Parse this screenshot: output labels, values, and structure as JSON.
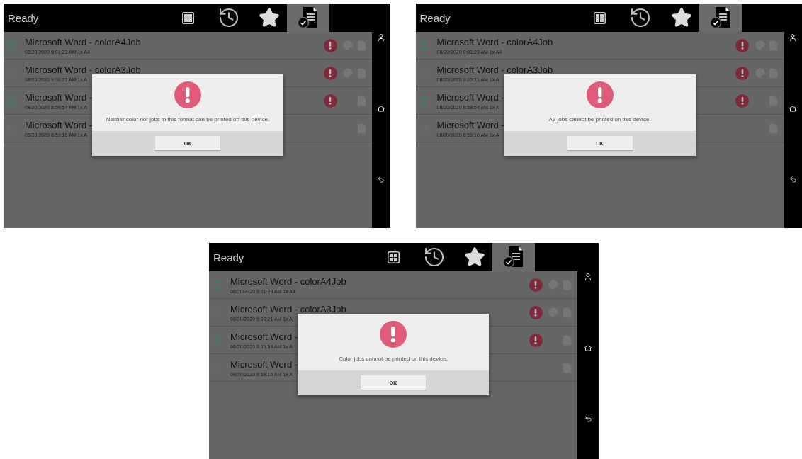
{
  "screens": [
    {
      "status": "Ready",
      "tabs": [
        {
          "kind": "grid",
          "selected": false
        },
        {
          "kind": "history",
          "selected": false
        },
        {
          "kind": "favorite",
          "selected": false
        },
        {
          "kind": "jobs",
          "selected": true
        }
      ],
      "jobs": [
        {
          "title": "Microsoft Word - colorA4Job",
          "details": "08/20/2020 9:01:23 AM 1x A4",
          "checked": false,
          "error": true,
          "color": true
        },
        {
          "title": "Microsoft Word - colorA3Job",
          "details": "08/20/2020 9:00:21 AM 1x A",
          "checked": false,
          "error": true,
          "color": true
        },
        {
          "title": "Microsoft Word -",
          "details": "08/20/2020 8:59:54 AM 1x A",
          "checked": false,
          "error": true,
          "color": false
        },
        {
          "title": "Microsoft Word -",
          "details": "08/20/2020 8:59:16 AM 1x A",
          "checked": false,
          "error": false,
          "color": false
        }
      ],
      "dialog": {
        "message": "Neither color nor jobs in this format can be printed on this device.",
        "button": "OK"
      }
    },
    {
      "status": "Ready",
      "tabs": [
        {
          "kind": "grid",
          "selected": false
        },
        {
          "kind": "history",
          "selected": false
        },
        {
          "kind": "favorite",
          "selected": false
        },
        {
          "kind": "jobs",
          "selected": true
        }
      ],
      "jobs": [
        {
          "title": "Microsoft Word - colorA4Job",
          "details": "08/20/2020 9:01:23 AM 1x A4",
          "checked": false,
          "error": true,
          "color": true
        },
        {
          "title": "Microsoft Word - colorA3Job",
          "details": "08/20/2020 9:00:21 AM 1x A",
          "checked": false,
          "error": true,
          "color": true
        },
        {
          "title": "Microsoft Word -",
          "details": "08/20/2020 8:59:54 AM 1x A",
          "checked": false,
          "error": true,
          "color": false
        },
        {
          "title": "Microsoft Word -",
          "details": "08/20/2020 8:59:16 AM 1x A",
          "checked": false,
          "error": false,
          "color": false
        }
      ],
      "dialog": {
        "message": "A3 jobs cannot be printed on this device.",
        "button": "OK"
      }
    },
    {
      "status": "Ready",
      "tabs": [
        {
          "kind": "grid",
          "selected": false
        },
        {
          "kind": "history",
          "selected": false
        },
        {
          "kind": "favorite",
          "selected": false
        },
        {
          "kind": "jobs",
          "selected": true
        }
      ],
      "jobs": [
        {
          "title": "Microsoft Word - colorA4Job",
          "details": "08/20/2020 9:01:23 AM 1x A4",
          "checked": false,
          "error": true,
          "color": true
        },
        {
          "title": "Microsoft Word - colorA3Job",
          "details": "08/20/2020 9:00:21 AM 1x A",
          "checked": false,
          "error": true,
          "color": true
        },
        {
          "title": "Microsoft Word -",
          "details": "08/20/2020 8:59:54 AM 1x A",
          "checked": false,
          "error": true,
          "color": false
        },
        {
          "title": "Microsoft Word -",
          "details": "08/20/2020 8:59:16 AM 1x A",
          "checked": false,
          "error": false,
          "color": false
        }
      ],
      "dialog": {
        "message": "Color jobs cannot be printed on this device.",
        "button": "OK"
      }
    }
  ]
}
